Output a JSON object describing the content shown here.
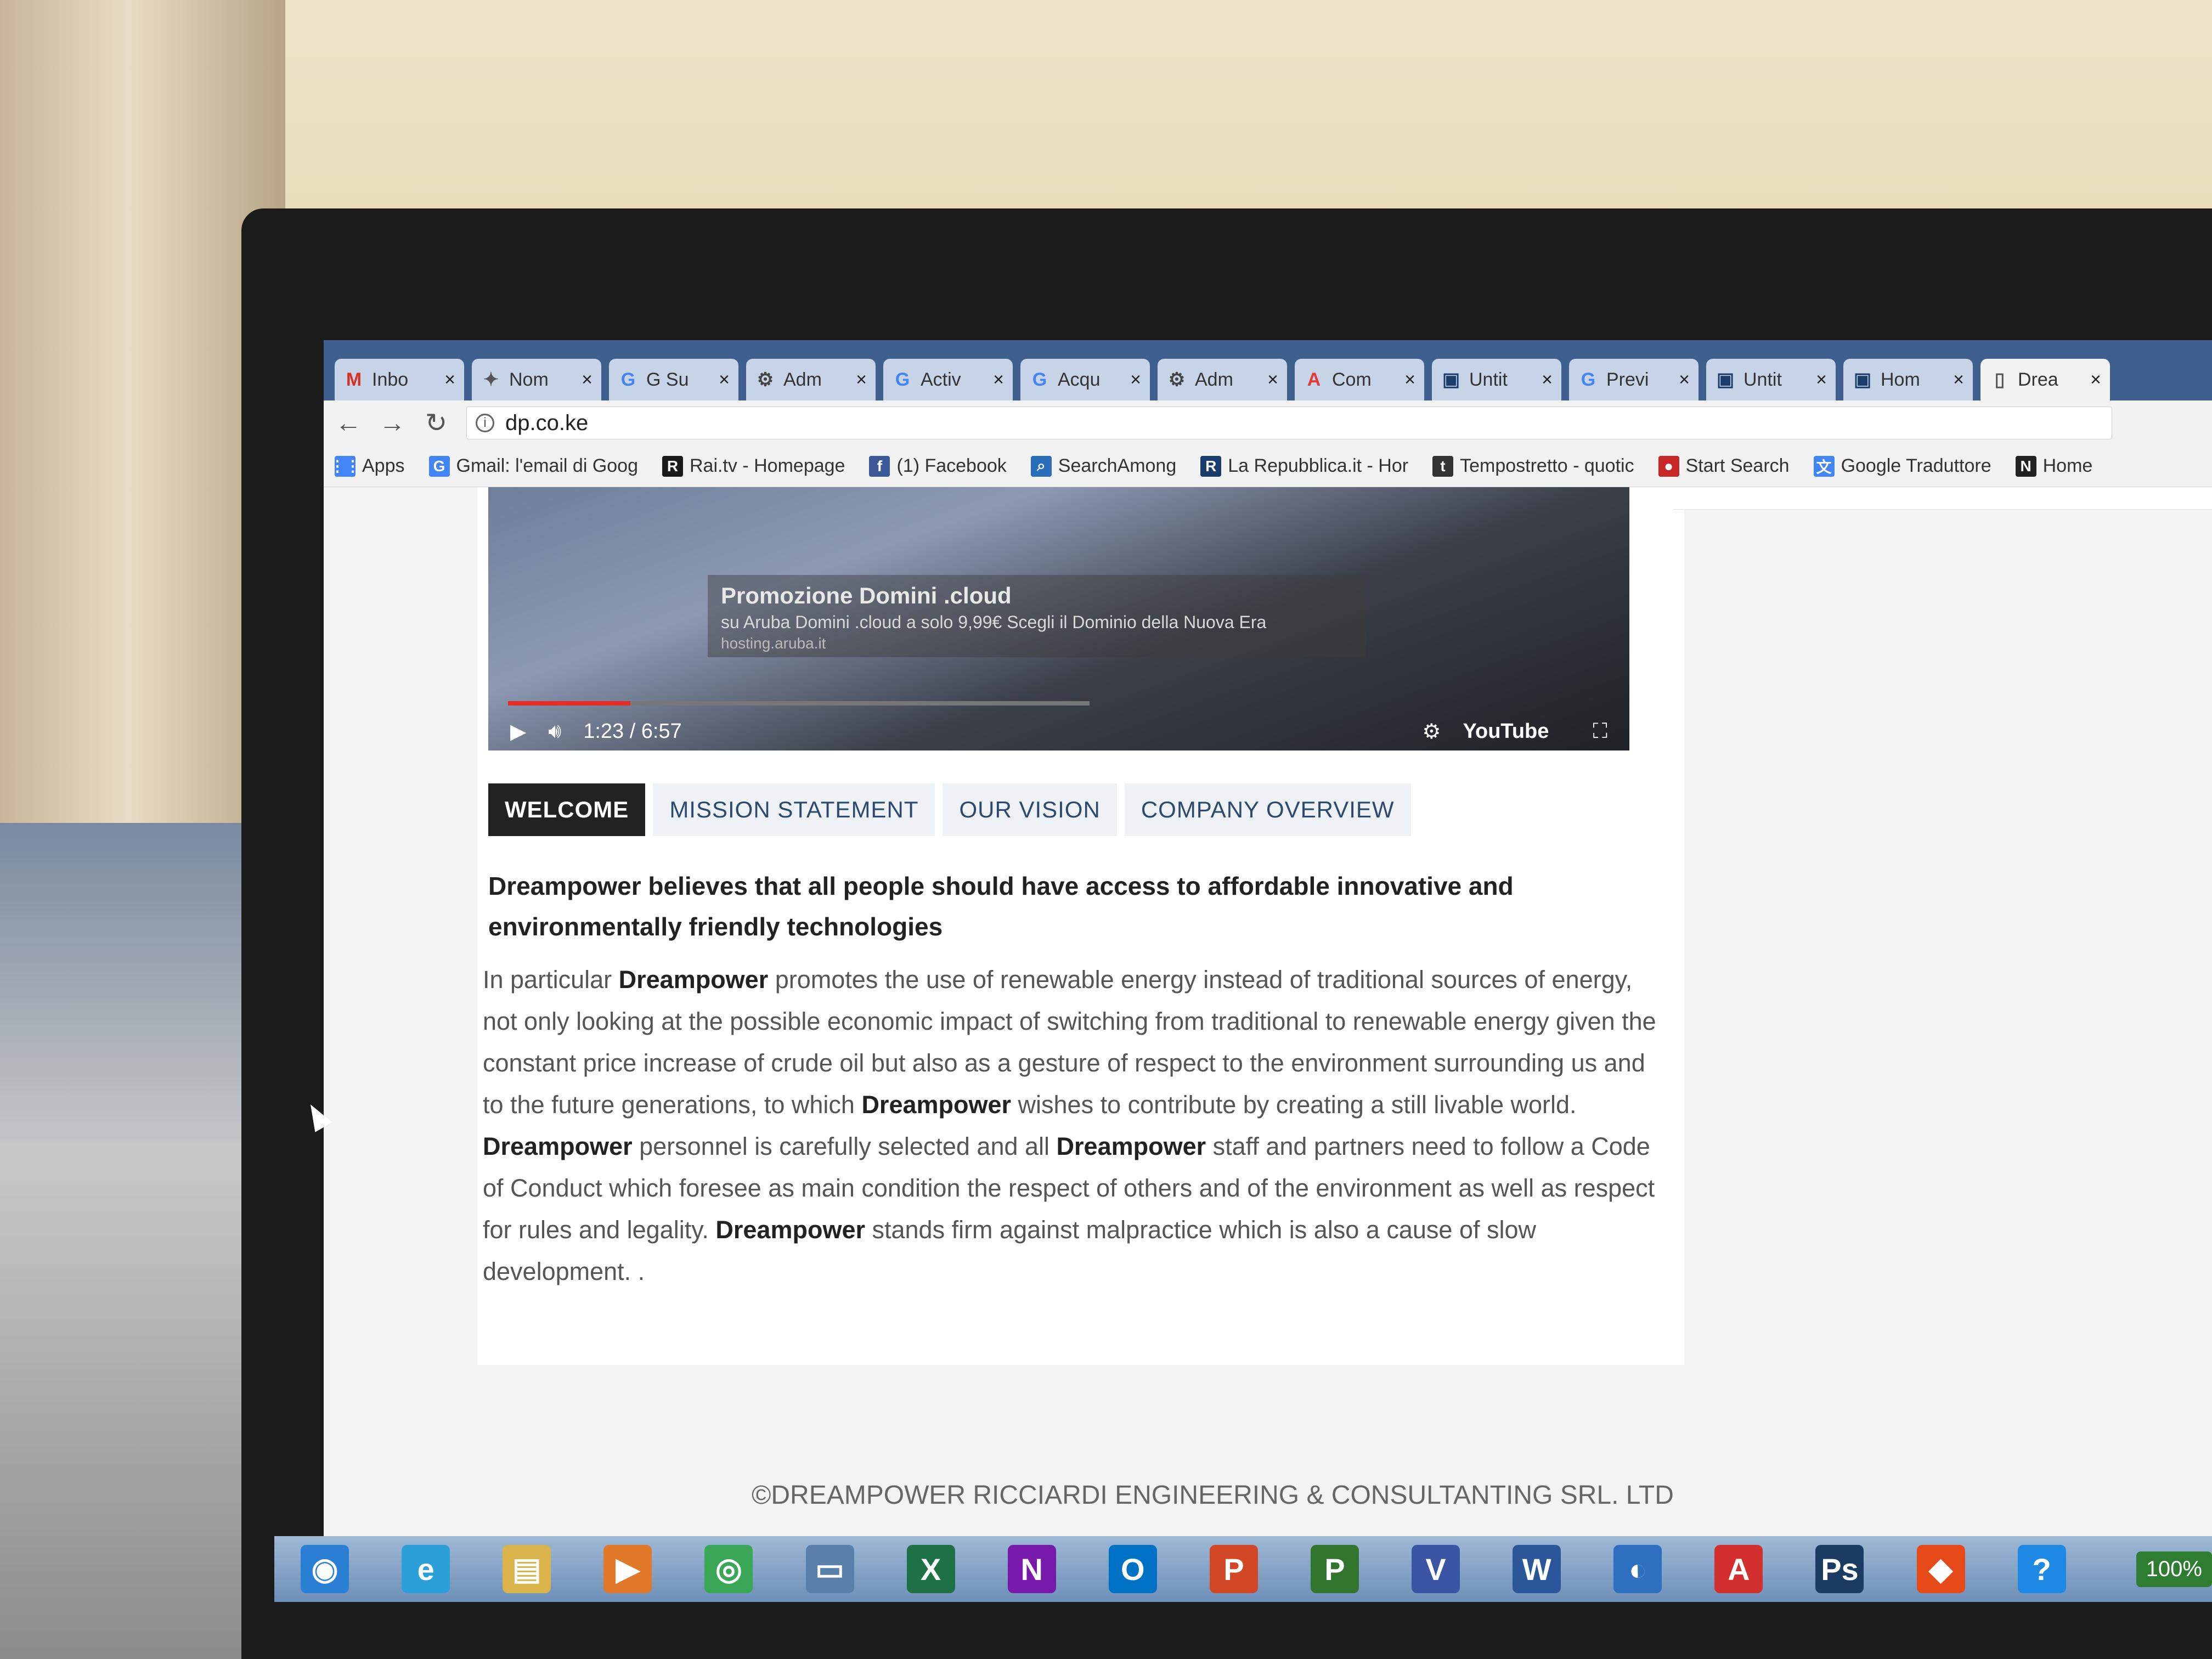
{
  "browser": {
    "tabs": [
      {
        "label": "Inbo",
        "icon": "gmail-icon",
        "color": "#d93025",
        "glyph": "M"
      },
      {
        "label": "Nom",
        "icon": "generic-page-icon",
        "color": "#555555",
        "glyph": "✦"
      },
      {
        "label": "G Su",
        "icon": "google-icon",
        "color": "#4285f4",
        "glyph": "G"
      },
      {
        "label": "Adm",
        "icon": "admin-gear-icon",
        "color": "#444444",
        "glyph": "⚙"
      },
      {
        "label": "Activ",
        "icon": "google-icon",
        "color": "#4285f4",
        "glyph": "G"
      },
      {
        "label": "Acqu",
        "icon": "google-icon",
        "color": "#4285f4",
        "glyph": "G"
      },
      {
        "label": "Adm",
        "icon": "admin-gear-icon",
        "color": "#444444",
        "glyph": "⚙"
      },
      {
        "label": "Com",
        "icon": "aruba-icon",
        "color": "#e53935",
        "glyph": "A"
      },
      {
        "label": "Untit",
        "icon": "page-layout-icon",
        "color": "#1a3d6e",
        "glyph": "▣"
      },
      {
        "label": "Previ",
        "icon": "google-icon",
        "color": "#4285f4",
        "glyph": "G"
      },
      {
        "label": "Untit",
        "icon": "page-layout-icon",
        "color": "#1a3d6e",
        "glyph": "▣"
      },
      {
        "label": "Hom",
        "icon": "page-layout-icon",
        "color": "#1a3d6e",
        "glyph": "▣"
      },
      {
        "label": "Drea",
        "icon": "document-icon",
        "color": "#555555",
        "glyph": "▯"
      }
    ],
    "close_glyph": "×",
    "url": "dp.co.ke",
    "bookmarks": [
      {
        "label": "Apps",
        "icon": "apps-grid-icon",
        "color": "#4285f4",
        "glyph": "⋮⋮"
      },
      {
        "label": "Gmail: l'email di Goog",
        "icon": "google-icon",
        "color": "#4285f4",
        "glyph": "G"
      },
      {
        "label": "Rai.tv - Homepage",
        "icon": "rai-icon",
        "color": "#1a1a1a",
        "glyph": "R"
      },
      {
        "label": "(1) Facebook",
        "icon": "facebook-icon",
        "color": "#3b5998",
        "glyph": "f"
      },
      {
        "label": "SearchAmong",
        "icon": "magnifier-icon",
        "color": "#2a6ebb",
        "glyph": "⌕"
      },
      {
        "label": "La Repubblica.it - Hor",
        "icon": "repubblica-icon",
        "color": "#1a3d6e",
        "glyph": "R"
      },
      {
        "label": "Tempostretto - quotic",
        "icon": "tempostretto-icon",
        "color": "#333333",
        "glyph": "t"
      },
      {
        "label": "Start Search",
        "icon": "start-search-icon",
        "color": "#c62828",
        "glyph": "●"
      },
      {
        "label": "Google Traduttore",
        "icon": "translate-icon",
        "color": "#4285f4",
        "glyph": "文"
      },
      {
        "label": "Home",
        "icon": "home-n-icon",
        "color": "#222222",
        "glyph": "N"
      }
    ]
  },
  "video": {
    "promo_title": "Promozione Domini .cloud",
    "promo_sub": "su Aruba Domini .cloud a solo 9,99€ Scegli il Dominio della Nuova Era",
    "promo_host": "hosting.aruba.it",
    "time": "1:23 / 6:57",
    "progress": 0.21,
    "yt_label": "YouTube"
  },
  "page_tabs": [
    {
      "label": "WELCOME",
      "active": true
    },
    {
      "label": "MISSION STATEMENT",
      "active": false
    },
    {
      "label": "OUR VISION",
      "active": false
    },
    {
      "label": "COMPANY OVERVIEW",
      "active": false
    }
  ],
  "content": {
    "lead": "Dreampower believes that all people should have access to affordable innovative and environmentally friendly technologies",
    "p1_a": "In particular ",
    "p1_b": "Dreampower",
    "p1_c": " promotes the use of renewable energy instead of traditional sources of energy, not only looking at the possible economic impact of switching from traditional to renewable energy given the constant price increase of crude oil but also as a gesture of respect to the environment surrounding us and to the future generations, to which ",
    "p1_d": "Dreampower",
    "p1_e": " wishes to contribute by creating a still livable world.",
    "p2_a": "Dreampower",
    "p2_b": " personnel is carefully selected and all ",
    "p2_c": "Dreampower",
    "p2_d": " staff and partners need to follow a Code of Conduct which foresee as main condition the respect of others and of the environment as well as respect for rules and legality. ",
    "p2_e": "Dreampower",
    "p2_f": " stands firm against malpractice which is also a cause of slow development. ."
  },
  "footer": "©DREAMPOWER RICCIARDI ENGINEERING & CONSULTANTING SRL. LTD",
  "taskbar": {
    "items": [
      {
        "name": "start-orb-icon",
        "glyph": "◉",
        "color": "#2a7fd4"
      },
      {
        "name": "internet-explorer-icon",
        "glyph": "e",
        "color": "#2a9fd8"
      },
      {
        "name": "file-explorer-icon",
        "glyph": "▤",
        "color": "#d9b44a"
      },
      {
        "name": "media-player-icon",
        "glyph": "▶",
        "color": "#e07a2a"
      },
      {
        "name": "chrome-icon",
        "glyph": "◎",
        "color": "#3aa757"
      },
      {
        "name": "app-window-icon",
        "glyph": "▭",
        "color": "#5a7fa8"
      },
      {
        "name": "excel-icon",
        "glyph": "X",
        "color": "#1e7145"
      },
      {
        "name": "onenote-icon",
        "glyph": "N",
        "color": "#7719aa"
      },
      {
        "name": "outlook-icon",
        "glyph": "O",
        "color": "#0072c6"
      },
      {
        "name": "powerpoint-icon",
        "glyph": "P",
        "color": "#d24726"
      },
      {
        "name": "project-icon",
        "glyph": "P",
        "color": "#31752f"
      },
      {
        "name": "visio-icon",
        "glyph": "V",
        "color": "#3955a3"
      },
      {
        "name": "word-icon",
        "glyph": "W",
        "color": "#2b579a"
      },
      {
        "name": "thunderbird-icon",
        "glyph": "◐",
        "color": "#2e6fbf"
      },
      {
        "name": "acrobat-icon",
        "glyph": "A",
        "color": "#d32f2f"
      },
      {
        "name": "photoshop-icon",
        "glyph": "Ps",
        "color": "#1c3b63"
      },
      {
        "name": "office-tools-icon",
        "glyph": "◆",
        "color": "#e64a19"
      },
      {
        "name": "help-icon",
        "glyph": "?",
        "color": "#1e88e5"
      }
    ],
    "zoom": "100%"
  }
}
